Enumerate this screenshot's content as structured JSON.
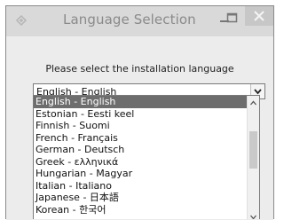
{
  "window": {
    "title": "Language Selection",
    "app_icon": "installer-icon",
    "controls": {
      "minimize": "minimize-icon",
      "maximize": "maximize-icon",
      "close": "close-icon"
    }
  },
  "prompt": "Please select the installation language",
  "select": {
    "value": "English - English",
    "arrow_icon": "chevron-down-icon"
  },
  "dropdown": {
    "items": [
      "English - English",
      "Estonian - Eesti keel",
      "Finnish - Suomi",
      "French - Français",
      "German - Deutsch",
      "Greek - ελληνικά",
      "Hungarian - Magyar",
      "Italian - Italiano",
      "Japanese - 日本語",
      "Korean - 한국어"
    ],
    "selected_index": 0,
    "scroll_position": 0.35
  },
  "colors": {
    "selection": "#6d6d6d",
    "titlebar": "#d9d9d9",
    "client": "#ececec"
  }
}
